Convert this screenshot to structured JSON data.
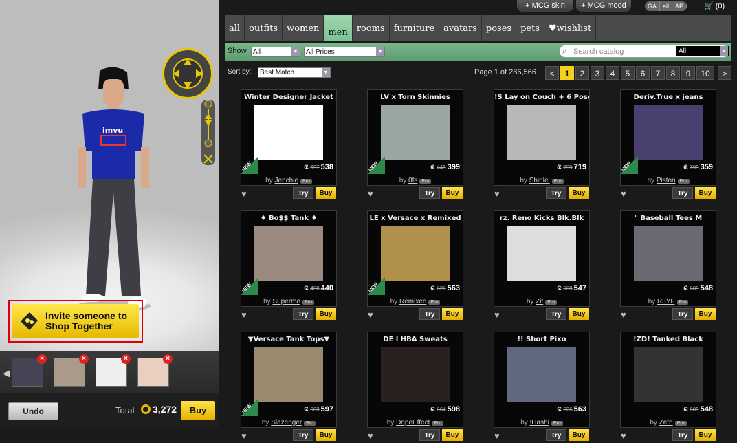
{
  "topbar": {
    "mcg_skin": "+ MCG skin",
    "mcg_mood": "+ MCG mood",
    "ga": "GA",
    "all": "all",
    "ap": "AP",
    "cart": "(0)"
  },
  "tabs": [
    "all",
    "outfits",
    "women",
    "men",
    "rooms",
    "furniture",
    "avatars",
    "poses",
    "pets",
    "wishlist"
  ],
  "active_tab": "men",
  "filter": {
    "show_label": "Show",
    "show_value": "All",
    "prices_value": "All Prices",
    "search_placeholder": "Search catalog",
    "search_scope": "All"
  },
  "sort": {
    "label": "Sort by:",
    "value": "Best Match"
  },
  "pagination": {
    "info": "Page 1 of 286,566",
    "prev": "<",
    "next": ">",
    "pages": [
      "1",
      "2",
      "3",
      "4",
      "5",
      "6",
      "7",
      "8",
      "9",
      "10"
    ],
    "current": "1"
  },
  "invite": {
    "text": "Invite someone to\nShop Together"
  },
  "bottom": {
    "undo": "Undo",
    "total_label": "Total",
    "total_value": "3,272",
    "buy": "Buy"
  },
  "avatar_shirt_text": "imvu",
  "products": [
    {
      "title": "Winter Designer Jacket",
      "old": "597",
      "price": "538",
      "creator": "Jenchie",
      "new": true,
      "thumb": "#ffffff"
    },
    {
      "title": "LV x Torn Skinnies",
      "old": "443",
      "price": "399",
      "creator": "0fs",
      "new": true,
      "thumb": "#9aa6a3"
    },
    {
      "title": "!S Lay on Couch + 6 Pose",
      "old": "799",
      "price": "719",
      "creator": "Shinlei",
      "new": false,
      "thumb": "#b8b8b8"
    },
    {
      "title": "Deriv.True x jeans",
      "old": "399",
      "price": "359",
      "creator": "Piston",
      "new": true,
      "thumb": "#4a4070"
    },
    {
      "title": "♦ Bo$$ Tank ♦",
      "old": "488",
      "price": "440",
      "creator": "Superme",
      "new": true,
      "thumb": "#9a8a80"
    },
    {
      "title": "LE x Versace x Remixed",
      "old": "626",
      "price": "563",
      "creator": "Remixed",
      "new": true,
      "thumb": "#b0904a"
    },
    {
      "title": "rz. Reno Kicks Blk.Blk",
      "old": "608",
      "price": "547",
      "creator": "Zit",
      "new": false,
      "thumb": "#ddd"
    },
    {
      "title": "\" Baseball Tees M",
      "old": "609",
      "price": "548",
      "creator": "R3YF",
      "new": false,
      "thumb": "#6a6a72"
    },
    {
      "title": "▼Versace Tank Tops▼",
      "old": "663",
      "price": "597",
      "creator": "Slazenger",
      "new": true,
      "thumb": "#9a8a70"
    },
    {
      "title": "DE l HBA Sweats",
      "old": "664",
      "price": "598",
      "creator": "DopeEffect",
      "new": false,
      "thumb": "#2a2020"
    },
    {
      "title": "!! Short Pixo",
      "old": "626",
      "price": "563",
      "creator": "!Hashi",
      "new": false,
      "thumb": "#606880"
    },
    {
      "title": "!ZD! Tanked Black",
      "old": "609",
      "price": "548",
      "creator": "Zeth",
      "new": false,
      "thumb": "#333"
    }
  ],
  "card_buttons": {
    "try": "Try",
    "buy": "Buy"
  },
  "colors": {
    "accent_green": "#7cc394",
    "buy_yellow": "#f3d21a",
    "alert_red": "#e00000"
  }
}
